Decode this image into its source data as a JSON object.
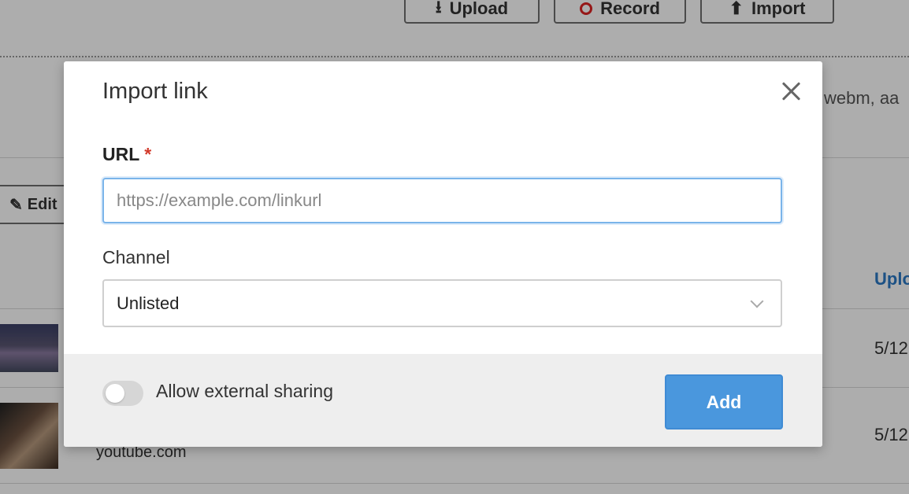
{
  "background": {
    "buttons": {
      "upload": "Upload",
      "record": "Record",
      "import": "Import"
    },
    "supported_formats_fragment": "webm, aa",
    "edit_label": "Edit",
    "column_header_fragment": "Uplo",
    "rows": [
      {
        "date_fragment": "5/12"
      },
      {
        "source": "youtube.com",
        "date_fragment": "5/12"
      }
    ]
  },
  "modal": {
    "title": "Import link",
    "url": {
      "label": "URL",
      "required_marker": "*",
      "value": "",
      "placeholder": "https://example.com/linkurl"
    },
    "channel": {
      "label": "Channel",
      "selected": "Unlisted"
    },
    "footer": {
      "toggle_label": "Allow external sharing",
      "toggle_on": false,
      "add_label": "Add"
    }
  },
  "colors": {
    "primary_button": "#4a97dd",
    "required_star": "#d23a2a",
    "link_header": "#2a78c4",
    "focus_border": "#7ab4ea"
  }
}
